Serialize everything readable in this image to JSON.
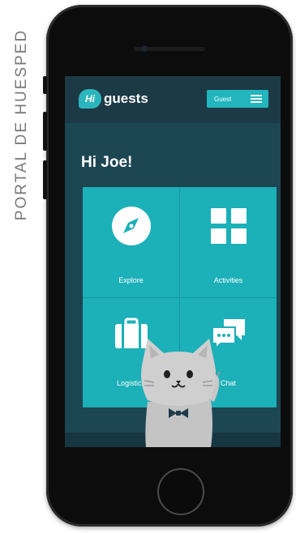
{
  "side_caption": "PORTAL DE HUESPED",
  "app": {
    "logo": {
      "badge_text": "Hi",
      "text": "guests"
    },
    "guest_button": {
      "label": "Guest"
    }
  },
  "greeting": "Hi Joe!",
  "tiles": [
    {
      "label": "Explore",
      "icon": "compass-icon"
    },
    {
      "label": "Activities",
      "icon": "grid-icon"
    },
    {
      "label": "Logistics",
      "icon": "suitcase-icon"
    },
    {
      "label": "Chat",
      "icon": "chat-bubbles-icon"
    }
  ],
  "colors": {
    "screen_bg": "#1d4653",
    "header_bg": "#1c3a46",
    "accent_teal": "#1cb0b8",
    "text": "#ffffff"
  }
}
